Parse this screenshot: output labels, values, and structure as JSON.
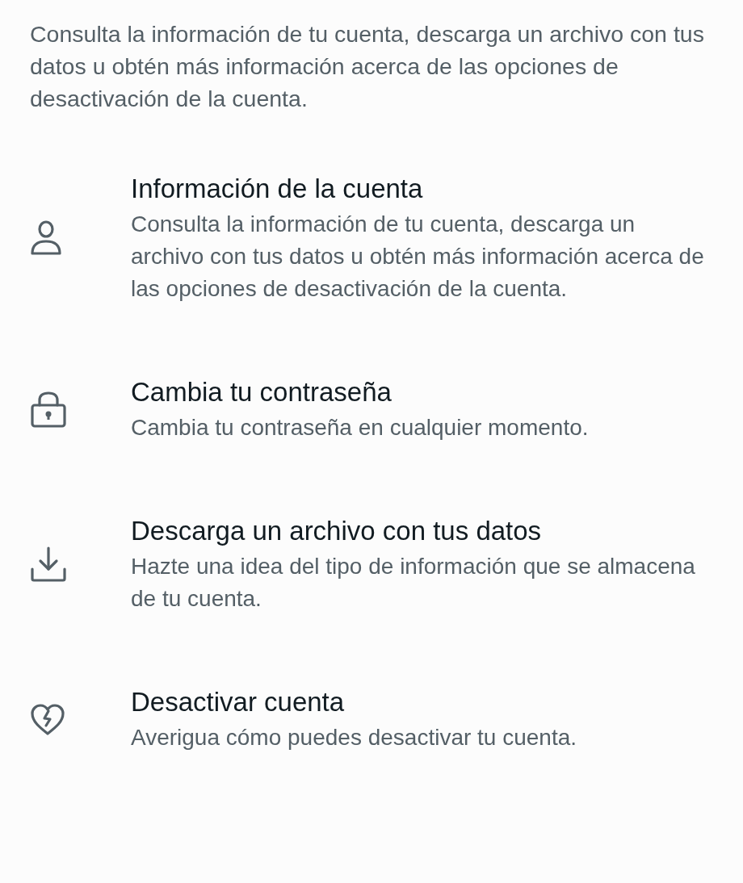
{
  "intro": "Consulta la información de tu cuenta, descarga un archivo con tus datos u obtén más información acerca de las opciones de desactivación de la cuenta.",
  "items": [
    {
      "kind": "person",
      "title": "Información de la cuenta",
      "description": "Consulta la información de tu cuenta, descarga un archivo con tus datos u obtén más información acerca de las opciones de desactivación de la cuenta."
    },
    {
      "kind": "lock",
      "title": "Cambia tu contraseña",
      "description": "Cambia tu contraseña en cualquier momento."
    },
    {
      "kind": "download",
      "title": "Descarga un archivo con tus datos",
      "description": "Hazte una idea del tipo de información que se almacena de tu cuenta."
    },
    {
      "kind": "broken-heart",
      "title": "Desactivar cuenta",
      "description": "Averigua cómo puedes desactivar tu cuenta."
    }
  ]
}
